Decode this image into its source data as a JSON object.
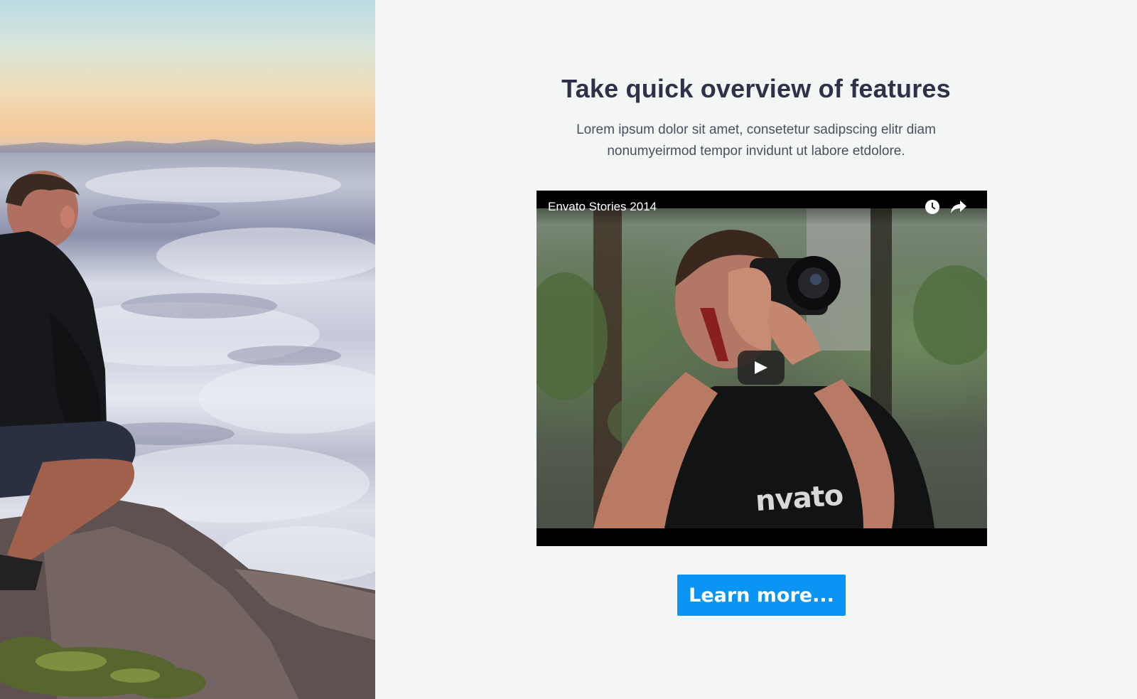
{
  "section": {
    "title": "Take quick overview of features",
    "subtitle": "Lorem ipsum dolor sit amet, consetetur sadipscing elitr diam nonumyeirmod tempor invidunt ut labore etdolore."
  },
  "video": {
    "title": "Envato Stories 2014",
    "watermark": "nvato",
    "icons": [
      "clock-icon",
      "share-icon",
      "play-icon"
    ]
  },
  "cta": {
    "label": "Learn more..."
  },
  "colors": {
    "background": "#f4f5f5",
    "title": "#2d3248",
    "subtitle": "#4a4f5c",
    "button": "#0a95f5"
  }
}
